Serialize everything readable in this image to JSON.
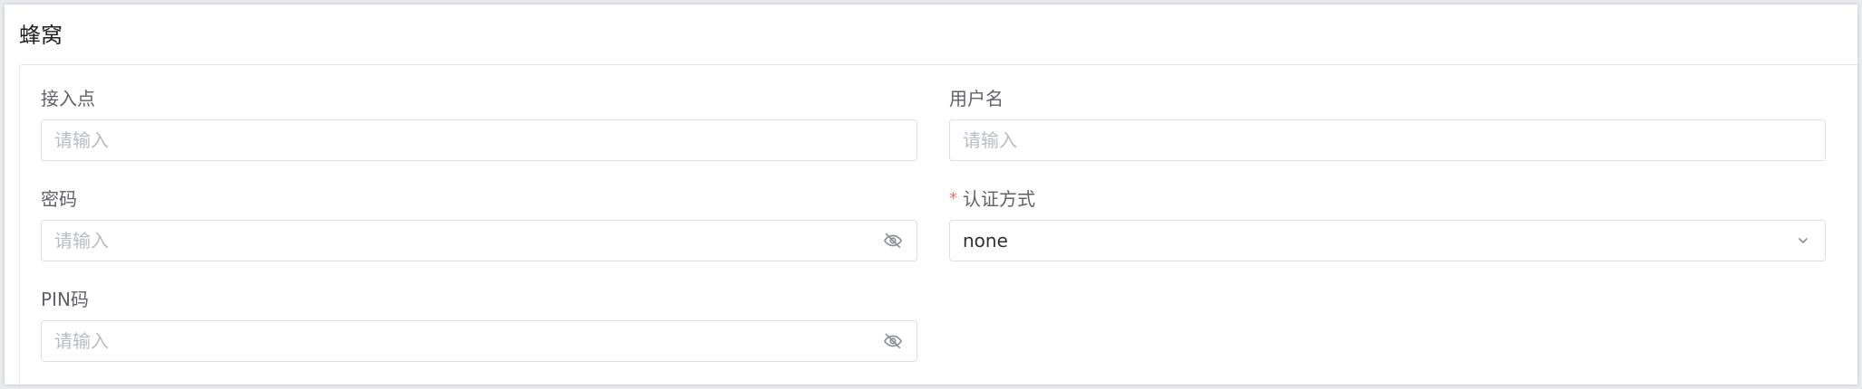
{
  "panel": {
    "title": "蜂窝"
  },
  "form": {
    "apn": {
      "label": "接入点",
      "value": "",
      "placeholder": "请输入"
    },
    "username": {
      "label": "用户名",
      "value": "",
      "placeholder": "请输入"
    },
    "password": {
      "label": "密码",
      "value": "",
      "placeholder": "请输入",
      "toggle_icon": "eye-off-icon"
    },
    "auth_method": {
      "label": "认证方式",
      "required_mark": "*",
      "selected": "none",
      "dropdown_icon": "chevron-down-icon"
    },
    "pin": {
      "label": "PIN码",
      "value": "",
      "placeholder": "请输入",
      "toggle_icon": "eye-off-icon"
    }
  },
  "colors": {
    "required": "#f56c6c",
    "label": "#606266",
    "placeholder": "#b8bcc4",
    "border": "#dcdfe6"
  }
}
